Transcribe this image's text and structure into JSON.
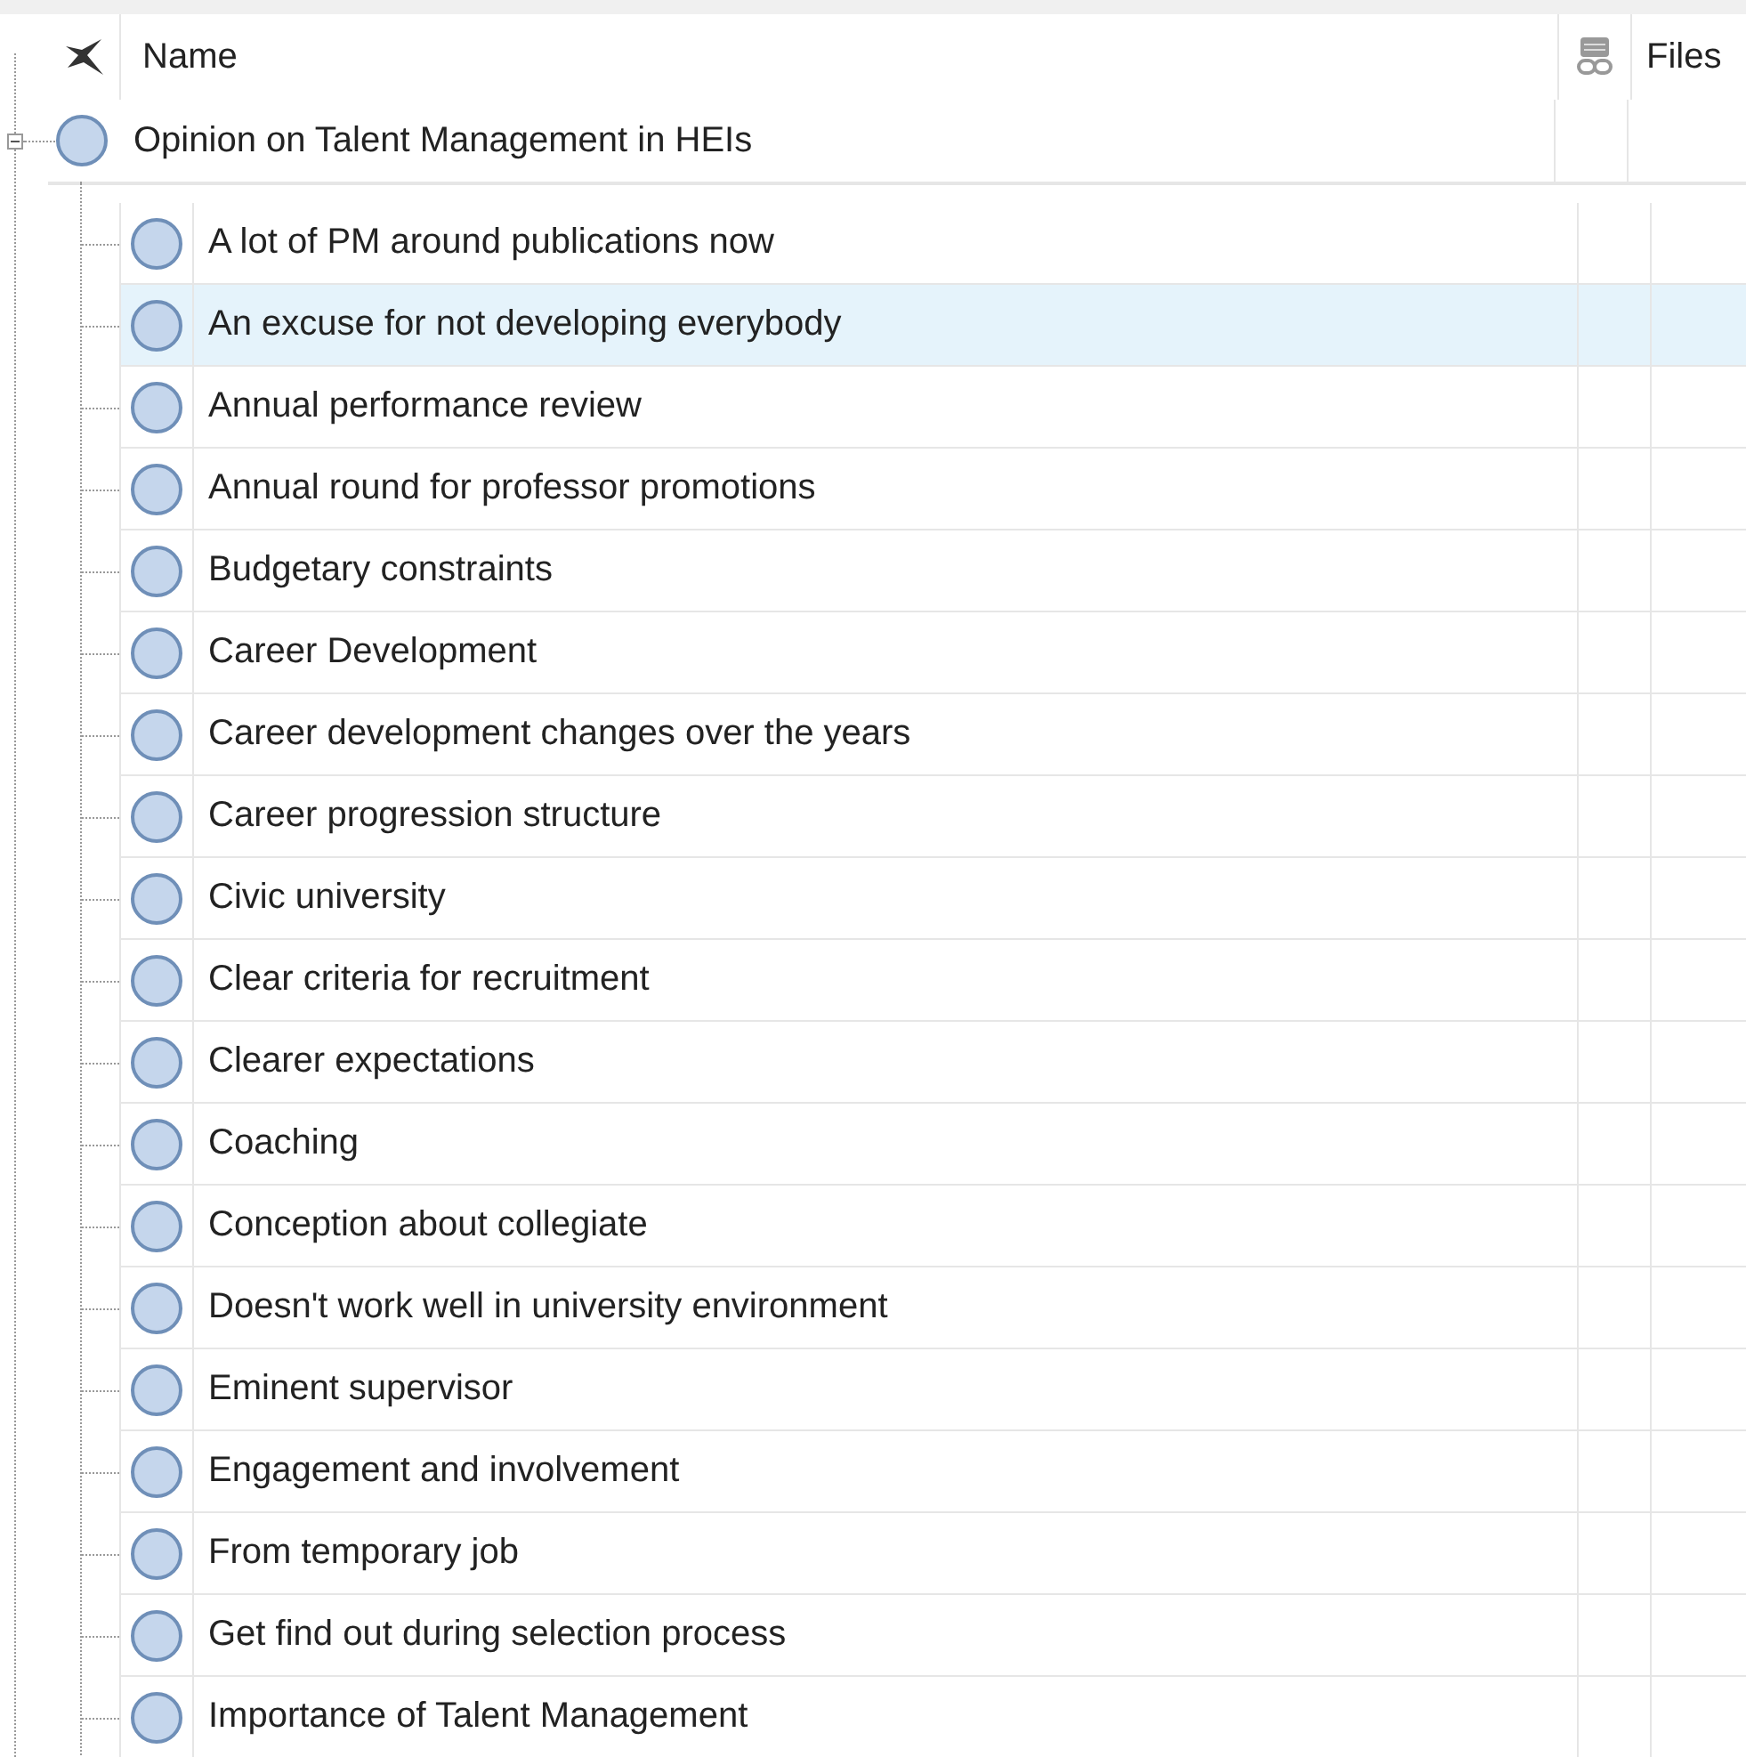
{
  "columns": [
    {
      "label": "Name"
    },
    {
      "label": "Files"
    }
  ],
  "root": {
    "name": "Opinion on Talent Management in HEIs",
    "expanded": true,
    "children": [
      {
        "name": "A lot of PM around publications now",
        "selected": false
      },
      {
        "name": "An excuse for not developing everybody",
        "selected": true
      },
      {
        "name": "Annual performance review",
        "selected": false
      },
      {
        "name": "Annual round for professor promotions",
        "selected": false
      },
      {
        "name": "Budgetary constraints",
        "selected": false
      },
      {
        "name": "Career Development",
        "selected": false
      },
      {
        "name": "Career development changes over the years",
        "selected": false
      },
      {
        "name": "Career progression structure",
        "selected": false
      },
      {
        "name": "Civic university",
        "selected": false
      },
      {
        "name": "Clear criteria for recruitment",
        "selected": false
      },
      {
        "name": "Clearer expectations",
        "selected": false
      },
      {
        "name": "Coaching",
        "selected": false
      },
      {
        "name": "Conception about collegiate",
        "selected": false
      },
      {
        "name": "Doesn't work well in university environment",
        "selected": false
      },
      {
        "name": "Eminent supervisor",
        "selected": false
      },
      {
        "name": "Engagement and involvement",
        "selected": false
      },
      {
        "name": "From temporary job",
        "selected": false
      },
      {
        "name": "Get find out during selection process",
        "selected": false
      },
      {
        "name": "Importance of Talent Management",
        "selected": false
      }
    ]
  }
}
